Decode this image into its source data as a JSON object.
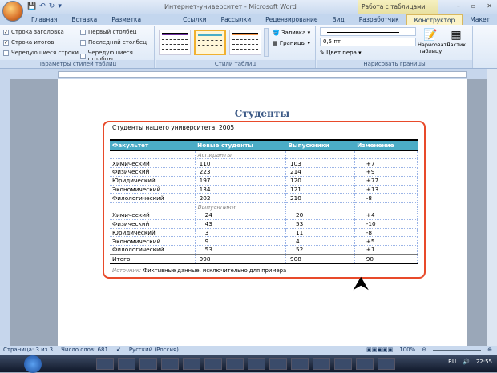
{
  "window": {
    "title": "Интернет-университет - Microsoft Word",
    "context_tab_group": "Работа с таблицами"
  },
  "tabs": [
    "Главная",
    "Вставка",
    "Разметка страницы",
    "Ссылки",
    "Рассылки",
    "Рецензирование",
    "Вид",
    "Разработчик",
    "Конструктор",
    "Макет"
  ],
  "active_tab": "Конструктор",
  "ribbon": {
    "options": {
      "label": "Параметры стилей таблиц",
      "items": [
        {
          "label": "Строка заголовка",
          "checked": true
        },
        {
          "label": "Строка итогов",
          "checked": true
        },
        {
          "label": "Чередующиеся строки",
          "checked": false
        },
        {
          "label": "Первый столбец",
          "checked": false
        },
        {
          "label": "Последний столбец",
          "checked": false
        },
        {
          "label": "Чередующиеся столбцы",
          "checked": false
        }
      ]
    },
    "styles": {
      "label": "Стили таблиц",
      "fill": "Заливка",
      "borders": "Границы",
      "style_colors": [
        "#7030a0",
        "#4bacc6",
        "#f79646"
      ]
    },
    "draw": {
      "label": "Нарисовать границы",
      "weight": "0,5 пт",
      "pen_color": "Цвет пера",
      "draw_table": "Нарисовать таблицу",
      "eraser": "Ластик"
    }
  },
  "document": {
    "heading": "Студенты",
    "caption": "Студенты нашего университета, 2005",
    "columns": [
      "Факультет",
      "Новые студенты",
      "Выпускники",
      "Изменение"
    ],
    "sections": [
      {
        "name": "Аспиранты",
        "rows": [
          [
            "Химический",
            "110",
            "103",
            "+7"
          ],
          [
            "Физический",
            "223",
            "214",
            "+9"
          ],
          [
            "Юридический",
            "197",
            "120",
            "+77"
          ],
          [
            "Экономический",
            "134",
            "121",
            "+13"
          ],
          [
            "Филологический",
            "202",
            "210",
            "-8"
          ]
        ]
      },
      {
        "name": "Выпускники",
        "rows": [
          [
            "Химический",
            "24",
            "20",
            "+4"
          ],
          [
            "Физический",
            "43",
            "53",
            "-10"
          ],
          [
            "Юридический",
            "3",
            "11",
            "-8"
          ],
          [
            "Экономический",
            "9",
            "4",
            "+5"
          ],
          [
            "Филологический",
            "53",
            "52",
            "+1"
          ]
        ]
      }
    ],
    "total": [
      "Итого",
      "998",
      "908",
      "90"
    ],
    "source_label": "Источник:",
    "source_text": "Фиктивные данные, исключительно для примера"
  },
  "status": {
    "page": "Страница: 3 из 3",
    "words": "Число слов: 681",
    "language": "Русский (Россия)",
    "zoom": "100%"
  },
  "taskbar": {
    "lang": "RU",
    "time": "22:55"
  }
}
